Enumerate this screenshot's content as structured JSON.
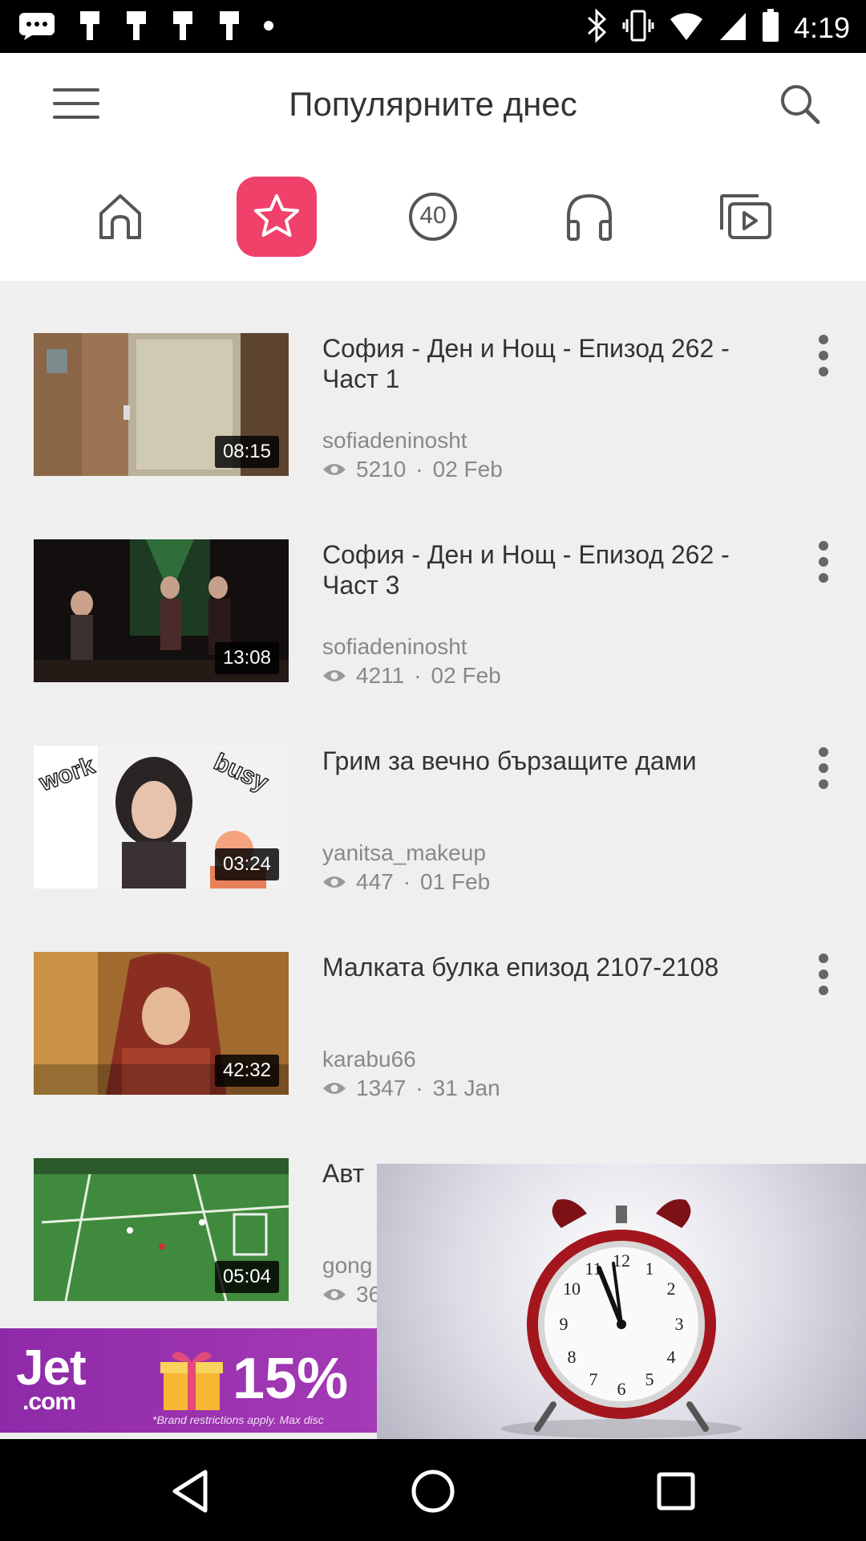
{
  "status_bar": {
    "time": "4:19",
    "left_icons": [
      "messages-icon",
      "notification-icon",
      "notification-icon",
      "notification-icon",
      "notification-icon",
      "dot-icon"
    ],
    "right_icons": [
      "bluetooth-icon",
      "vibrate-icon",
      "wifi-icon",
      "signal-icon",
      "battery-icon"
    ]
  },
  "header": {
    "title": "Популярните днес"
  },
  "nav_tabs": [
    {
      "icon": "home-icon"
    },
    {
      "icon": "star-icon",
      "active": true
    },
    {
      "icon": "top-40-icon",
      "label": "40"
    },
    {
      "icon": "headphones-icon"
    },
    {
      "icon": "playlist-icon"
    }
  ],
  "videos": [
    {
      "title": "София - Ден и Нощ - Епизод 262 - Част 1",
      "duration": "08:15",
      "channel": "sofiadeninosht",
      "views": "5210",
      "date": "02 Feb"
    },
    {
      "title": "София - Ден и Нощ - Епизод 262 - Част 3",
      "duration": "13:08",
      "channel": "sofiadeninosht",
      "views": "4211",
      "date": "02 Feb"
    },
    {
      "title": "Грим за вечно бързащите дами",
      "duration": "03:24",
      "channel": "yanitsa_makeup",
      "views": "447",
      "date": "01 Feb"
    },
    {
      "title": "Малката булка епизод 2107-2108",
      "duration": "42:32",
      "channel": "karabu66",
      "views": "1347",
      "date": "31 Jan"
    },
    {
      "title": "Авт",
      "duration": "05:04",
      "channel": "gong",
      "views": "36",
      "date": ""
    }
  ],
  "ad": {
    "brand": "Jet",
    "brand_suffix": ".com",
    "offer": "15%",
    "fine_print": "*Brand restrictions apply. Max disc"
  },
  "separator": "·",
  "colors": {
    "accent": "#f0416a",
    "text_primary": "#333333",
    "text_secondary": "#888888",
    "background": "#efefef"
  }
}
